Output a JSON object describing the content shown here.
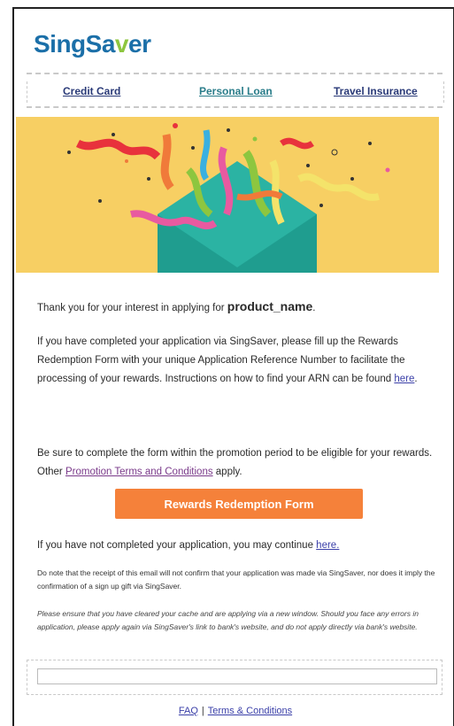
{
  "header": {
    "logo_sing": "SingSa",
    "logo_leaf": "v",
    "logo_er": "er"
  },
  "nav": {
    "items": [
      {
        "label": "Credit Card"
      },
      {
        "label": "Personal Loan"
      },
      {
        "label": "Travel Insurance"
      }
    ]
  },
  "content": {
    "thanks_prefix": "Thank you for your interest in applying for ",
    "product_name": "product_name",
    "thanks_suffix": ".",
    "para1": "If you have completed your application via SingSaver, please fill up the Rewards Redemption Form with your unique Application Reference Number to facilitate the processing of your rewards. Instructions on how to find your ARN can be found ",
    "para1_link": "here",
    "para1_end": ".",
    "para2": "Be sure to complete the form within the promotion period to be eligible for your rewards. Other ",
    "para2_link": "Promotion Terms and Conditions",
    "para2_end": " apply.",
    "cta_label": "Rewards Redemption Form",
    "para3": "If you have not completed your application, you may continue ",
    "para3_link": "here.",
    "note1": "Do note that the receipt of this email will not confirm that your application was made via SingSaver, nor does it imply the confirmation of a sign up gift via SingSaver.",
    "note2": "Please ensure that you have cleared your cache and are applying via a new window. Should you face any errors in application, please apply again via SingSaver's link to bank's website, and do not apply directly via bank's website."
  },
  "footer": {
    "faq": "FAQ",
    "separator": "|",
    "terms": "Terms & Conditions"
  },
  "colors": {
    "brand_blue": "#1b6fa8",
    "brand_green": "#8dc63f",
    "cta_orange": "#f5813a",
    "hero_yellow": "#f7cf63",
    "envelope_teal": "#2bb3a3"
  }
}
